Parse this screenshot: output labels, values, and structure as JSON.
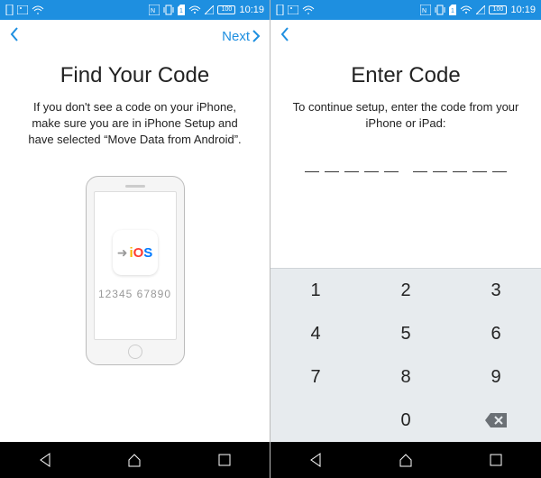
{
  "status": {
    "time": "10:19",
    "battery": "100"
  },
  "left": {
    "nav_next": "Next",
    "title": "Find Your Code",
    "subtitle": "If you don't see a code on your iPhone, make sure you are in iPhone Setup and have selected “Move Data from Android”.",
    "illustration": {
      "ios_label": "iOS",
      "code_sample": "12345 67890"
    }
  },
  "right": {
    "title": "Enter Code",
    "subtitle": "To continue setup, enter the code from your iPhone or iPad:",
    "keys": [
      "1",
      "2",
      "3",
      "4",
      "5",
      "6",
      "7",
      "8",
      "9",
      "",
      "0",
      "⌫"
    ]
  }
}
